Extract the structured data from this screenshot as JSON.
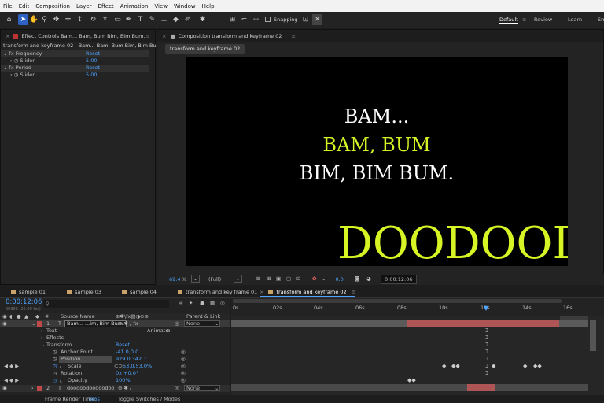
{
  "menu": [
    "File",
    "Edit",
    "Composition",
    "Layer",
    "Effect",
    "Animation",
    "View",
    "Window",
    "Help"
  ],
  "toolbar": {
    "snapping_label": "Snapping"
  },
  "workspaces": [
    "Default",
    "Review",
    "Learn",
    "Sm"
  ],
  "effect_controls": {
    "tab": "Effect Controls Bam... Bam, Bum Bim, Bim Bum.",
    "subtitle": "transform and keyframe 02 - Bam... Bam, Bum Bim, Bim Bum.",
    "groups": [
      {
        "name": "Frequency",
        "reset": "Reset",
        "slider_label": "Slider",
        "value": "5.00"
      },
      {
        "name": "Period",
        "reset": "Reset",
        "slider_label": "Slider",
        "value": "5.00"
      }
    ]
  },
  "composition": {
    "tab": "Composition transform and keyframe 02",
    "subtab": "transform and keyframe 02",
    "lines": [
      "BAM...",
      "BAM, BUM",
      "BIM, BIM BUM."
    ],
    "big_text": "DOODOOD",
    "zoom": "69.4",
    "zoom_unit": "%",
    "resolution": "(Full)",
    "exposure": "+0.0",
    "timecode": "0:00:12:06",
    "colors": {
      "white": "#ffffff",
      "accent": "#d7f424"
    }
  },
  "timeline": {
    "tabs": [
      "sample 01",
      "sample 03",
      "sample 04",
      "transform and key frame 01",
      "transform and keyframe 02"
    ],
    "timecode": "0:00:12:06",
    "frame_info": "00306 (25.00 fps)",
    "columns": {
      "source_name": "Source Name",
      "parent": "Parent & Link"
    },
    "ruler": [
      "0s",
      "02s",
      "04s",
      "06s",
      "08s",
      "10s",
      "12s",
      "14s",
      "16s"
    ],
    "layer1": {
      "num": "1",
      "name": "Bam... ...im, Bim Bum.",
      "parent": "None"
    },
    "text_label": "Text",
    "animate_label": "Animate:",
    "effects_label": "Effects",
    "transform_label": "Transform",
    "transform_reset": "Reset",
    "props": [
      {
        "name": "Anchor Point",
        "value": "-41.0,0.0"
      },
      {
        "name": "Position",
        "value": "929.0,342.7"
      },
      {
        "name": "Scale",
        "value": "53.0,53.0%"
      },
      {
        "name": "Rotation",
        "value": "0x +0.0°"
      },
      {
        "name": "Opacity",
        "value": "100%"
      }
    ],
    "layer2": {
      "num": "2",
      "name": "doodoodoodoodoo",
      "parent": "None"
    },
    "footer_left": "Frame Render Time:",
    "footer_time": "8ms",
    "footer_toggle": "Toggle Switches / Modes"
  }
}
